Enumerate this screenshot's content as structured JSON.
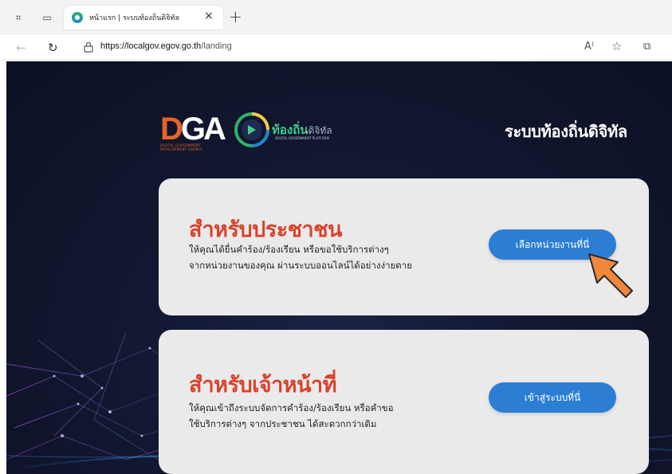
{
  "browser": {
    "tab_title": "หน้าแรก | ระบบท้องถิ่นดิจิทัล",
    "tab_close": "×",
    "new_tab": "+",
    "url_host": "https://localgov.egov.go.th",
    "url_path": "/landing",
    "read_aloud": "A⁾",
    "favorite": "☆",
    "split": "⧉"
  },
  "header": {
    "dga_logo": {
      "letters_d": "D",
      "letters_rest": "GA",
      "subtext": "DIGITAL GOVERNMENT DEVELOPMENT AGENCY"
    },
    "local_logo": {
      "brand_main": "ท้องถิ่น",
      "brand_suffix": "ดิจิทัล",
      "tagline": "DIGITAL GOVERNMENT PLATFORM"
    },
    "site_title": "ระบบท้องถิ่นดิจิทัล"
  },
  "cards": {
    "citizen": {
      "title": "สำหรับประชาชน",
      "desc_line1": "ให้คุณได้ยื่นคำร้อง/ร้องเรียน หรือขอใช้บริการต่างๆ",
      "desc_line2": "จากหน่วยงานของคุณ ผ่านระบบออนไลน์ได้อย่างง่ายดาย",
      "button": "เลือกหน่วยงานที่นี่"
    },
    "staff": {
      "title": "สำหรับเจ้าหน้าที่",
      "desc_line1": "ให้คุณเข้าถึงระบบจัดการคำร้อง/ร้องเรียน หรือคำขอ",
      "desc_line2": "ใช้บริการต่างๆ จากประชาชน ได้สะดวกกว่าเดิม",
      "button": "เข้าสู่ระบบที่นี่"
    }
  },
  "colors": {
    "accent_red": "#d9422c",
    "button_blue": "#2b7ed4",
    "page_dark": "#121831",
    "arrow_orange": "#f0873a"
  }
}
